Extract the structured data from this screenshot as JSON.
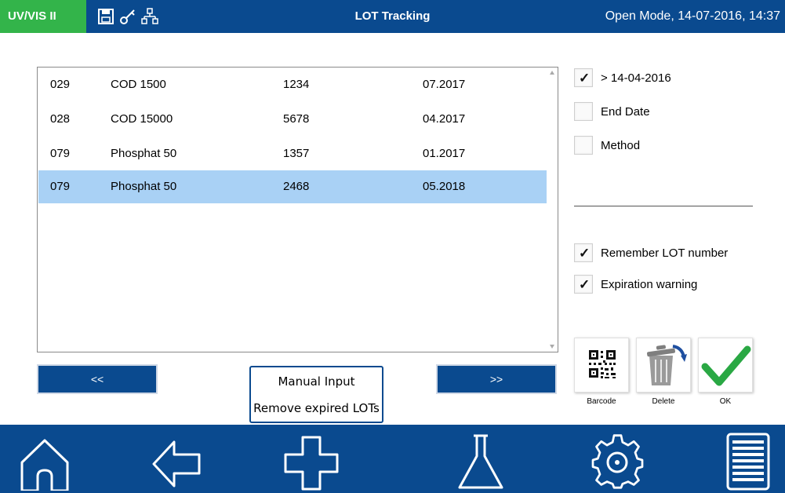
{
  "header": {
    "app_name": "UV/VIS II",
    "icons": [
      "save-icon",
      "key-icon",
      "network-icon"
    ],
    "title": "LOT Tracking",
    "status": "Open Mode, 14-07-2016, 14:37"
  },
  "lot_list": {
    "rows": [
      {
        "code": "029",
        "method": "COD 1500",
        "lot": "1234",
        "expiry": "07.2017",
        "selected": false
      },
      {
        "code": "028",
        "method": "COD 15000",
        "lot": "5678",
        "expiry": "04.2017",
        "selected": false
      },
      {
        "code": "079",
        "method": "Phosphat 50",
        "lot": "1357",
        "expiry": "01.2017",
        "selected": false
      },
      {
        "code": "079",
        "method": "Phosphat 50",
        "lot": "2468",
        "expiry": "05.2018",
        "selected": true
      }
    ]
  },
  "filters": {
    "date_filter": {
      "label": "> 14-04-2016",
      "checked": true
    },
    "end_date": {
      "label": "End Date",
      "checked": false
    },
    "method": {
      "label": "Method",
      "checked": false
    }
  },
  "settings": {
    "remember_lot": {
      "label": "Remember LOT number",
      "checked": true
    },
    "expiration_warning": {
      "label": "Expiration warning",
      "checked": true
    }
  },
  "paging": {
    "prev_label": "<<",
    "next_label": ">>"
  },
  "manual": {
    "manual_input_label": "Manual Input",
    "remove_expired_label": "Remove expired LOTs"
  },
  "actions": {
    "barcode_label": "Barcode",
    "delete_label": "Delete",
    "ok_label": "OK"
  },
  "bottom_nav": [
    "home-icon",
    "back-icon",
    "add-icon",
    "flask-icon",
    "settings-gear-icon",
    "menu-list-icon"
  ],
  "colors": {
    "primary_blue": "#0a4a8f",
    "badge_green": "#33b44a",
    "selection": "#a9d1f5",
    "ok_green": "#2aa844"
  }
}
